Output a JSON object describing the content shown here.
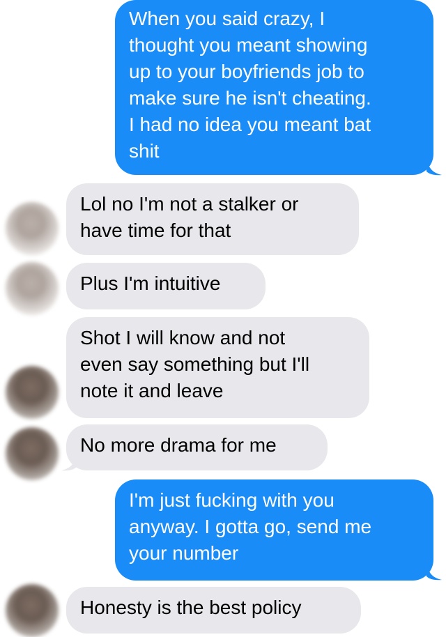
{
  "conversation": {
    "messages": [
      {
        "direction": "outgoing",
        "text": "When you said crazy, I\nthought you meant showing\nup to your boyfriends job to\nmake sure he isn't cheating.\nI had no idea you meant bat\nshit"
      },
      {
        "direction": "incoming",
        "text": "Lol no I'm not a stalker or\nhave  time for that"
      },
      {
        "direction": "incoming",
        "text": "Plus I'm intuitive"
      },
      {
        "direction": "incoming",
        "text": "Shot I will know and not\neven say something but I'll\nnote it and leave"
      },
      {
        "direction": "incoming",
        "text": "No more drama for me"
      },
      {
        "direction": "outgoing",
        "text": "I'm just fucking with you\nanyway. I gotta go, send me\nyour number"
      },
      {
        "direction": "incoming",
        "text": "Honesty is the best policy"
      }
    ]
  },
  "colors": {
    "outgoing_bubble": "#1a8cf7",
    "incoming_bubble": "#e8e7ec",
    "outgoing_text": "#ffffff",
    "incoming_text": "#000000"
  },
  "icons": {
    "contact_avatar": "blurred-contact-avatar-icon"
  }
}
